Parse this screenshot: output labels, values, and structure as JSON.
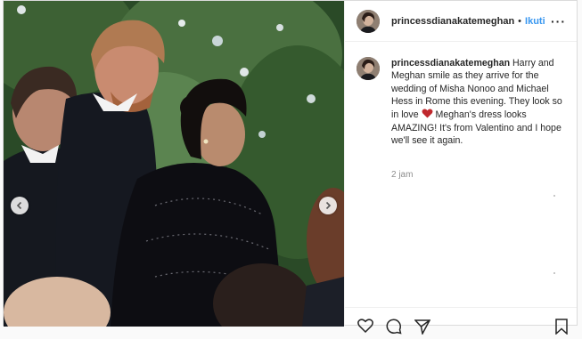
{
  "post": {
    "username": "princessdianakatemeghan",
    "dot": "•",
    "follow_label": "Ikuti",
    "more_label": "···",
    "caption_user": "princessdianakatemeghan",
    "caption_part1": " Harry and Meghan smile as they arrive for the wedding of Misha Nonoo and Michael Hess in Rome this evening. They look so in love ",
    "caption_part2": " Meghan's dress looks AMAZING! It's from Valentino and I hope we'll see it again.",
    "time_label": "2 jam"
  },
  "icons": {
    "prev": "chevron-left-icon",
    "next": "chevron-right-icon",
    "heart": "red-heart-emoji-icon",
    "like": "heart-outline-icon",
    "comment": "comment-icon",
    "share": "share-icon",
    "save": "bookmark-icon"
  },
  "colors": {
    "accent": "#3897f0",
    "text": "#262626",
    "muted": "#8e8e8e",
    "heart": "#c0282d"
  }
}
